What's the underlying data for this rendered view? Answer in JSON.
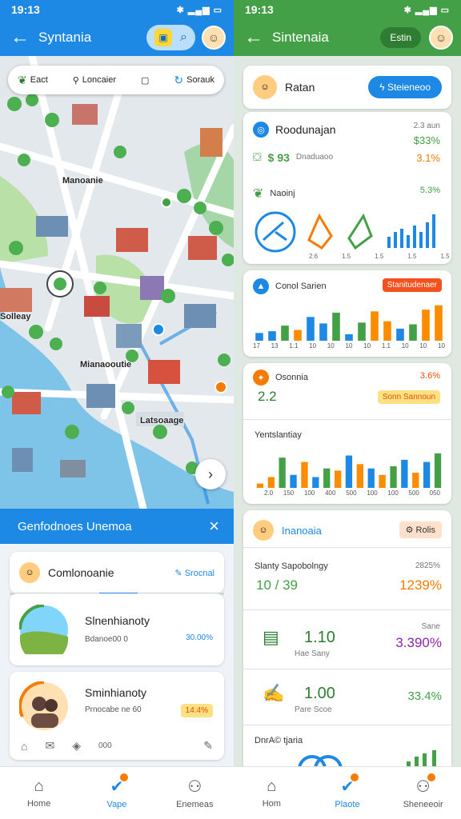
{
  "status_left": {
    "time": "19:13",
    "icons": "✱ ▂▄▆ ▭"
  },
  "status_right": {
    "time": "19:13",
    "icons": "✱ ▂▄▆ ▭"
  },
  "left_app": {
    "title": "Syntania"
  },
  "right_app": {
    "title": "Sintenaia",
    "pill_label": "Estin"
  },
  "map": {
    "chips": [
      {
        "label": "Eact"
      },
      {
        "label": "Loncaier"
      },
      {
        "label": ""
      },
      {
        "label": "Sorauk"
      }
    ],
    "labels": [
      "Manoanie",
      "Mianaooutie",
      "Latsoaage",
      "Solleay"
    ]
  },
  "sheet": {
    "title": "Genfodnoes Unemoa",
    "card1": {
      "title": "Comlonoanie",
      "link": "Srocnal"
    },
    "card2": {
      "title": "Slnenhianoty",
      "sub": "Bdanoe00 0",
      "value": "30.00%"
    },
    "card3": {
      "title": "Sminhianoty",
      "sub": "Prnocabe ne 60",
      "value": "14.4%"
    },
    "footer_text": "000"
  },
  "right": {
    "header": {
      "title": "Ratan",
      "button": "Steieneoo"
    },
    "card_a": {
      "title": "Roodunajan",
      "meta_right": "2.3 aun",
      "pct1": "$33%",
      "value1": "$ 93",
      "sub1": "Dnaduaoo",
      "pct2": "3.1%",
      "row2_title": "Naoinj",
      "row2_pct": "5.3%",
      "bar_labels": [
        "2.6",
        "1.5",
        "1.5",
        "1.5",
        "1.5",
        "1.5"
      ]
    },
    "card_b": {
      "title": "Conol Sarien",
      "tag": "Stanitudenaer",
      "xlabels": [
        "17",
        "13",
        "1.1",
        "10",
        "10",
        "10",
        "10",
        "1.1",
        "10",
        "10",
        "10",
        "10",
        "10",
        "1.1",
        "10"
      ]
    },
    "card_c": {
      "title": "Osonnia",
      "pct": "3.6%",
      "value": "2.2",
      "tag": "Sonn Sannoun",
      "sub_title": "Yentslantiay",
      "xlabels": [
        "2.0",
        "150",
        "100",
        "400",
        "500",
        "100",
        "100",
        "500",
        "050"
      ]
    },
    "card_d": {
      "title": "Inanoaia",
      "tag": "Rolis",
      "r1_title": "Slanty Sapobolngy",
      "r1_value": "10 / 39",
      "r1_pct_top": "2825%",
      "r1_pct": "1239%",
      "r2_value": "1.10",
      "r2_sub": "Hae Sany",
      "r2_top": "Sane",
      "r2_pct": "3.390%",
      "r3_value": "1.00",
      "r3_sub": "Pare Scoe",
      "r3_pct": "33.4%",
      "r4_title": "DnrA© tjaria"
    }
  },
  "nav_left": [
    {
      "label": "Home",
      "icon": "home-icon"
    },
    {
      "label": "Vape",
      "icon": "check-icon"
    },
    {
      "label": "Enemeas",
      "icon": "person-icon"
    }
  ],
  "nav_right": [
    {
      "label": "Hom",
      "icon": "home-icon"
    },
    {
      "label": "Plaote",
      "icon": "check-icon"
    },
    {
      "label": "Sheneeoir",
      "icon": "person-icon"
    }
  ],
  "chart_b_values": [
    {
      "c": "#1e88e5",
      "v": 0.18
    },
    {
      "c": "#1e88e5",
      "v": 0.22
    },
    {
      "c": "#43a047",
      "v": 0.35
    },
    {
      "c": "#fb8c00",
      "v": 0.25
    },
    {
      "c": "#1e88e5",
      "v": 0.55
    },
    {
      "c": "#1e88e5",
      "v": 0.4
    },
    {
      "c": "#43a047",
      "v": 0.65
    },
    {
      "c": "#1e88e5",
      "v": 0.15
    },
    {
      "c": "#43a047",
      "v": 0.42
    },
    {
      "c": "#fb8c00",
      "v": 0.68
    },
    {
      "c": "#fb8c00",
      "v": 0.45
    },
    {
      "c": "#1e88e5",
      "v": 0.28
    },
    {
      "c": "#43a047",
      "v": 0.38
    },
    {
      "c": "#fb8c00",
      "v": 0.72
    },
    {
      "c": "#fb8c00",
      "v": 0.82
    }
  ],
  "chart_c_values": [
    {
      "c": "#fb8c00",
      "v": 0.1
    },
    {
      "c": "#fb8c00",
      "v": 0.25
    },
    {
      "c": "#43a047",
      "v": 0.7
    },
    {
      "c": "#1e88e5",
      "v": 0.3
    },
    {
      "c": "#fb8c00",
      "v": 0.6
    },
    {
      "c": "#1e88e5",
      "v": 0.25
    },
    {
      "c": "#43a047",
      "v": 0.45
    },
    {
      "c": "#fb8c00",
      "v": 0.4
    },
    {
      "c": "#1e88e5",
      "v": 0.75
    },
    {
      "c": "#fb8c00",
      "v": 0.55
    },
    {
      "c": "#1e88e5",
      "v": 0.45
    },
    {
      "c": "#fb8c00",
      "v": 0.3
    },
    {
      "c": "#43a047",
      "v": 0.5
    },
    {
      "c": "#1e88e5",
      "v": 0.65
    },
    {
      "c": "#fb8c00",
      "v": 0.35
    },
    {
      "c": "#1e88e5",
      "v": 0.6
    },
    {
      "c": "#43a047",
      "v": 0.8
    }
  ]
}
